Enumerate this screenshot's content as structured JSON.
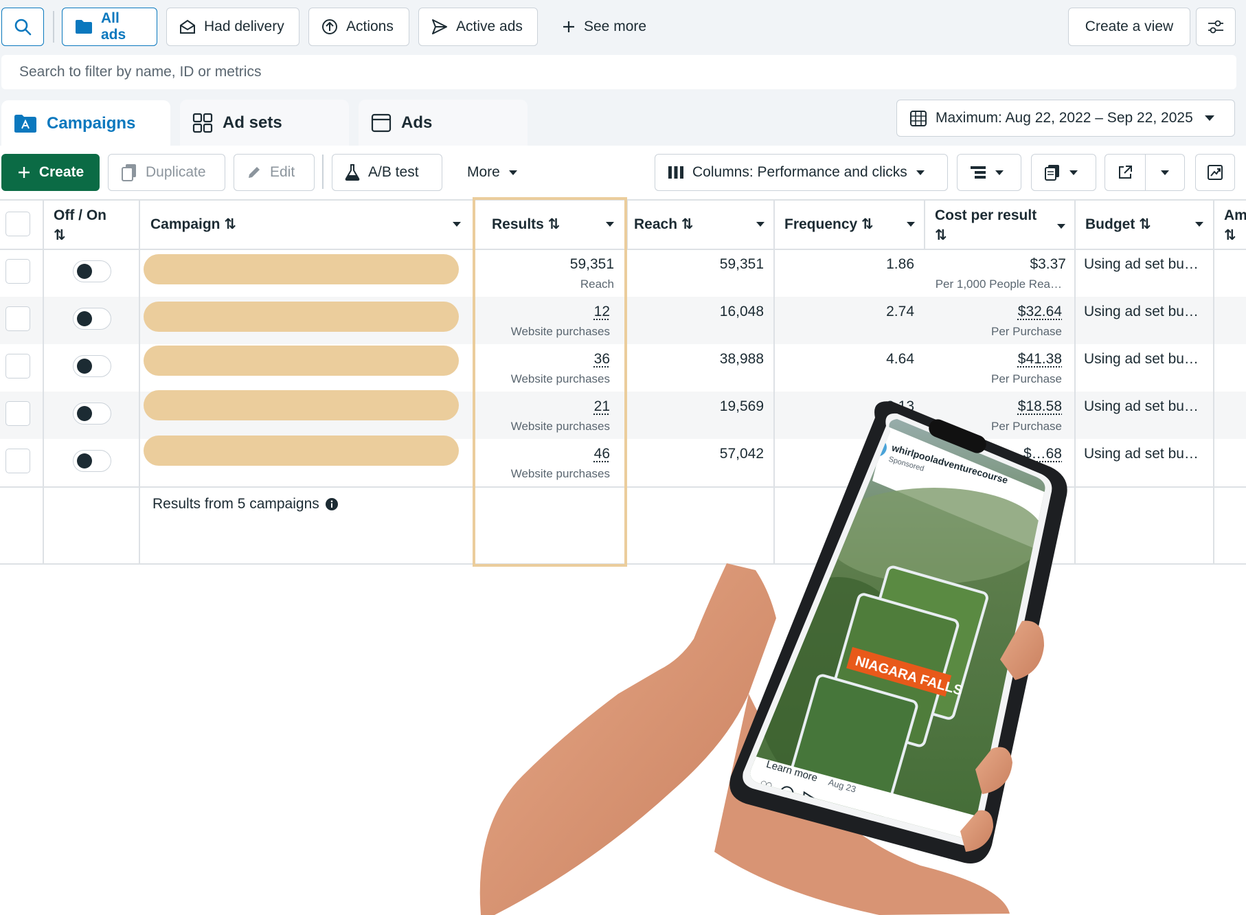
{
  "filters": {
    "all_ads": "All ads",
    "had_delivery": "Had delivery",
    "actions": "Actions",
    "active_ads": "Active ads",
    "see_more": "See more",
    "create_view": "Create a view",
    "search_placeholder": "Search to filter by name, ID or metrics"
  },
  "tabs": {
    "campaigns": "Campaigns",
    "ad_sets": "Ad sets",
    "ads": "Ads"
  },
  "date_range": "Maximum: Aug 22, 2022 – Sep 22, 2025",
  "toolbar": {
    "create": "Create",
    "duplicate": "Duplicate",
    "edit": "Edit",
    "ab_test": "A/B test",
    "more": "More",
    "columns": "Columns: Performance and clicks"
  },
  "table": {
    "headers": {
      "off_on": "Off / On",
      "campaign": "Campaign",
      "results": "Results",
      "reach": "Reach",
      "frequency": "Frequency",
      "cost_line1": "Cost per result",
      "budget": "Budget",
      "amount_truncated": "Am"
    },
    "rows": [
      {
        "results": "59,351",
        "results_type": "Reach",
        "reach": "59,351",
        "frequency": "1.86",
        "cost": "$3.37",
        "cost_type": "Per 1,000 People Rea…",
        "budget": "Using ad set bu…"
      },
      {
        "results": "12",
        "results_type": "Website purchases",
        "reach": "16,048",
        "frequency": "2.74",
        "cost": "$32.64",
        "cost_type": "Per Purchase",
        "budget": "Using ad set bu…"
      },
      {
        "results": "36",
        "results_type": "Website purchases",
        "reach": "38,988",
        "frequency": "4.64",
        "cost": "$41.38",
        "cost_type": "Per Purchase",
        "budget": "Using ad set bu…"
      },
      {
        "results": "21",
        "results_type": "Website purchases",
        "reach": "19,569",
        "frequency": "2.13",
        "cost": "$18.58",
        "cost_type": "Per Purchase",
        "budget": "Using ad set bu…"
      },
      {
        "results": "46",
        "results_type": "Website purchases",
        "reach": "57,042",
        "frequency": "",
        "cost": "$…68",
        "cost_type": "",
        "budget": "Using ad set bu…"
      }
    ],
    "footer": "Results from 5 campaigns"
  },
  "phone": {
    "account": "whirlpooladventurecourse",
    "sponsored": "Sponsored",
    "banner": "NIAGARA FALLS",
    "learn_more": "Learn more",
    "date": "Aug 23"
  },
  "colors": {
    "accent": "#0a78be",
    "create_green": "#0b6b45",
    "highlight": "#ebcd9c",
    "banner": "#e8591a"
  }
}
